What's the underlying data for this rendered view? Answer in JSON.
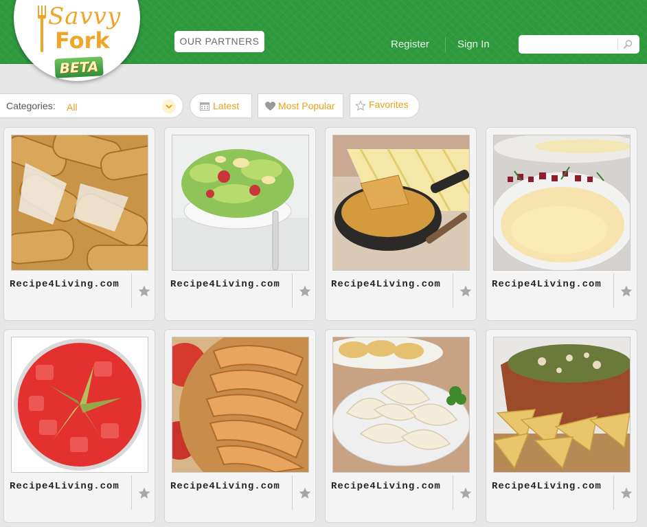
{
  "header": {
    "logo": {
      "line1": "Savvy",
      "line2": "Fork",
      "badge": "BETA"
    },
    "partners_label": "OUR PARTNERS",
    "nav": {
      "register": "Register",
      "sign_in": "Sign In"
    },
    "search": {
      "value": "",
      "placeholder": ""
    }
  },
  "filters": {
    "categories_label": "Categories:",
    "categories_value": "All",
    "latest_label": "Latest",
    "most_popular_label": "Most Popular",
    "favorites_label": "Favorites"
  },
  "cards": [
    {
      "source": "Recipe4Living.com",
      "image": "sausage-rolls"
    },
    {
      "source": "Recipe4Living.com",
      "image": "salad-bowl"
    },
    {
      "source": "Recipe4Living.com",
      "image": "cornbread-skillet"
    },
    {
      "source": "Recipe4Living.com",
      "image": "soup-plate"
    },
    {
      "source": "Recipe4Living.com",
      "image": "red-drink"
    },
    {
      "source": "Recipe4Living.com",
      "image": "apple-tart"
    },
    {
      "source": "Recipe4Living.com",
      "image": "pierogi-plate"
    },
    {
      "source": "Recipe4Living.com",
      "image": "spinach-dip"
    }
  ],
  "colors": {
    "header_green": "#2e9a3e",
    "accent_orange": "#e8a21c",
    "star_gray": "#a8a8a8"
  }
}
